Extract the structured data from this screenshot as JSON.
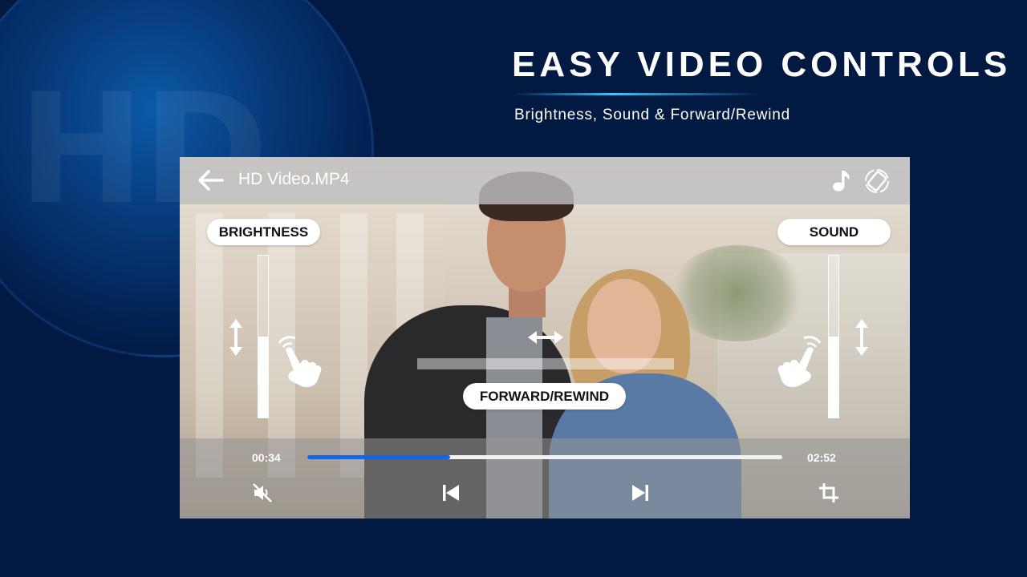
{
  "promo": {
    "watermark": "HD",
    "headline": "EASY VIDEO CONTROLS",
    "subheadline": "Brightness, Sound & Forward/Rewind"
  },
  "player": {
    "title": "HD Video.MP4",
    "top_icons": [
      "back-arrow-icon",
      "music-note-icon",
      "screen-rotation-icon"
    ],
    "gestures": {
      "brightness_label": "BRIGHTNESS",
      "sound_label": "SOUND",
      "seek_label": "FORWARD/REWIND",
      "brightness_level": 0.5,
      "sound_level": 0.5
    },
    "playback": {
      "current_time": "00:34",
      "total_time": "02:52",
      "progress": 0.3
    },
    "bottom_icons": [
      "mute-icon",
      "previous-icon",
      "next-icon",
      "crop-icon"
    ],
    "colors": {
      "accent": "#1565e8",
      "background": "#021942"
    }
  }
}
